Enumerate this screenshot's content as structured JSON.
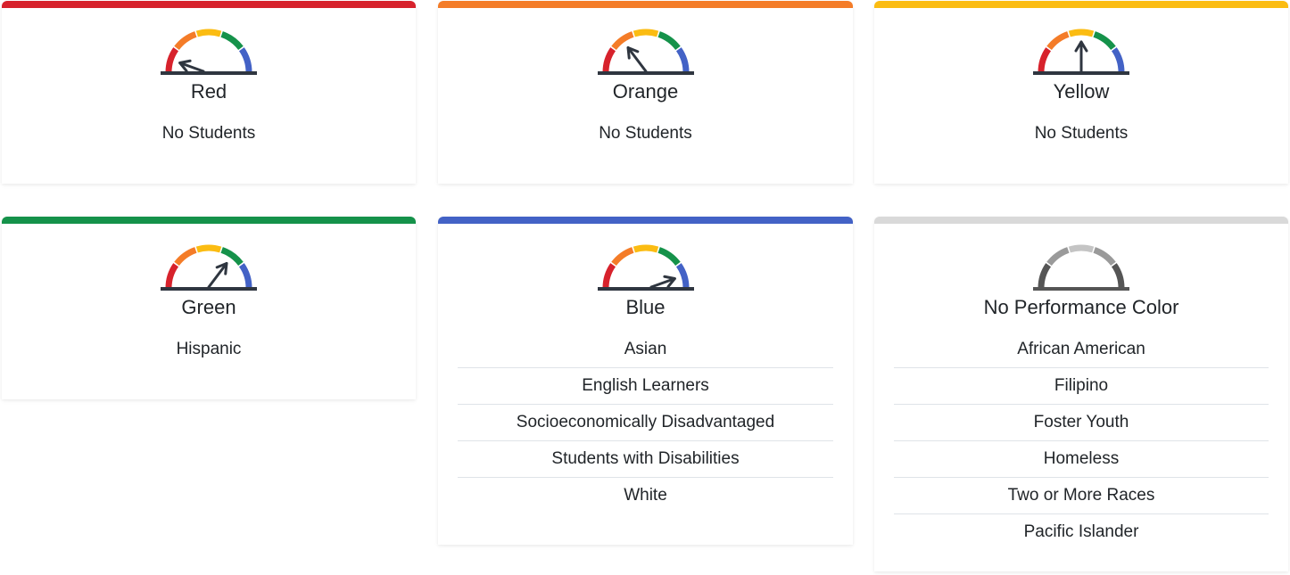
{
  "colors": {
    "red": "#d7222c",
    "orange": "#f47c28",
    "yellow": "#fbbc12",
    "green": "#15924a",
    "blue": "#4362c6",
    "gray_border": "#d9d9d9",
    "needle": "#2f3640"
  },
  "cards": [
    {
      "key": "red",
      "title": "Red",
      "accent": "#d7222c",
      "gauge_level": 1,
      "items": [
        "No Students"
      ]
    },
    {
      "key": "orange",
      "title": "Orange",
      "accent": "#f47c28",
      "gauge_level": 2,
      "items": [
        "No Students"
      ]
    },
    {
      "key": "yellow",
      "title": "Yellow",
      "accent": "#fbbc12",
      "gauge_level": 3,
      "items": [
        "No Students"
      ]
    },
    {
      "key": "green",
      "title": "Green",
      "accent": "#15924a",
      "gauge_level": 4,
      "items": [
        "Hispanic"
      ]
    },
    {
      "key": "blue",
      "title": "Blue",
      "accent": "#4362c6",
      "gauge_level": 5,
      "items": [
        "Asian",
        "English Learners",
        "Socioeconomically Disadvantaged",
        "Students with Disabilities",
        "White"
      ]
    },
    {
      "key": "none",
      "title": "No Performance Color",
      "accent": "#d9d9d9",
      "gauge_level": 0,
      "items": [
        "African American",
        "Filipino",
        "Foster Youth",
        "Homeless",
        "Two or More Races",
        "Pacific Islander"
      ]
    }
  ]
}
